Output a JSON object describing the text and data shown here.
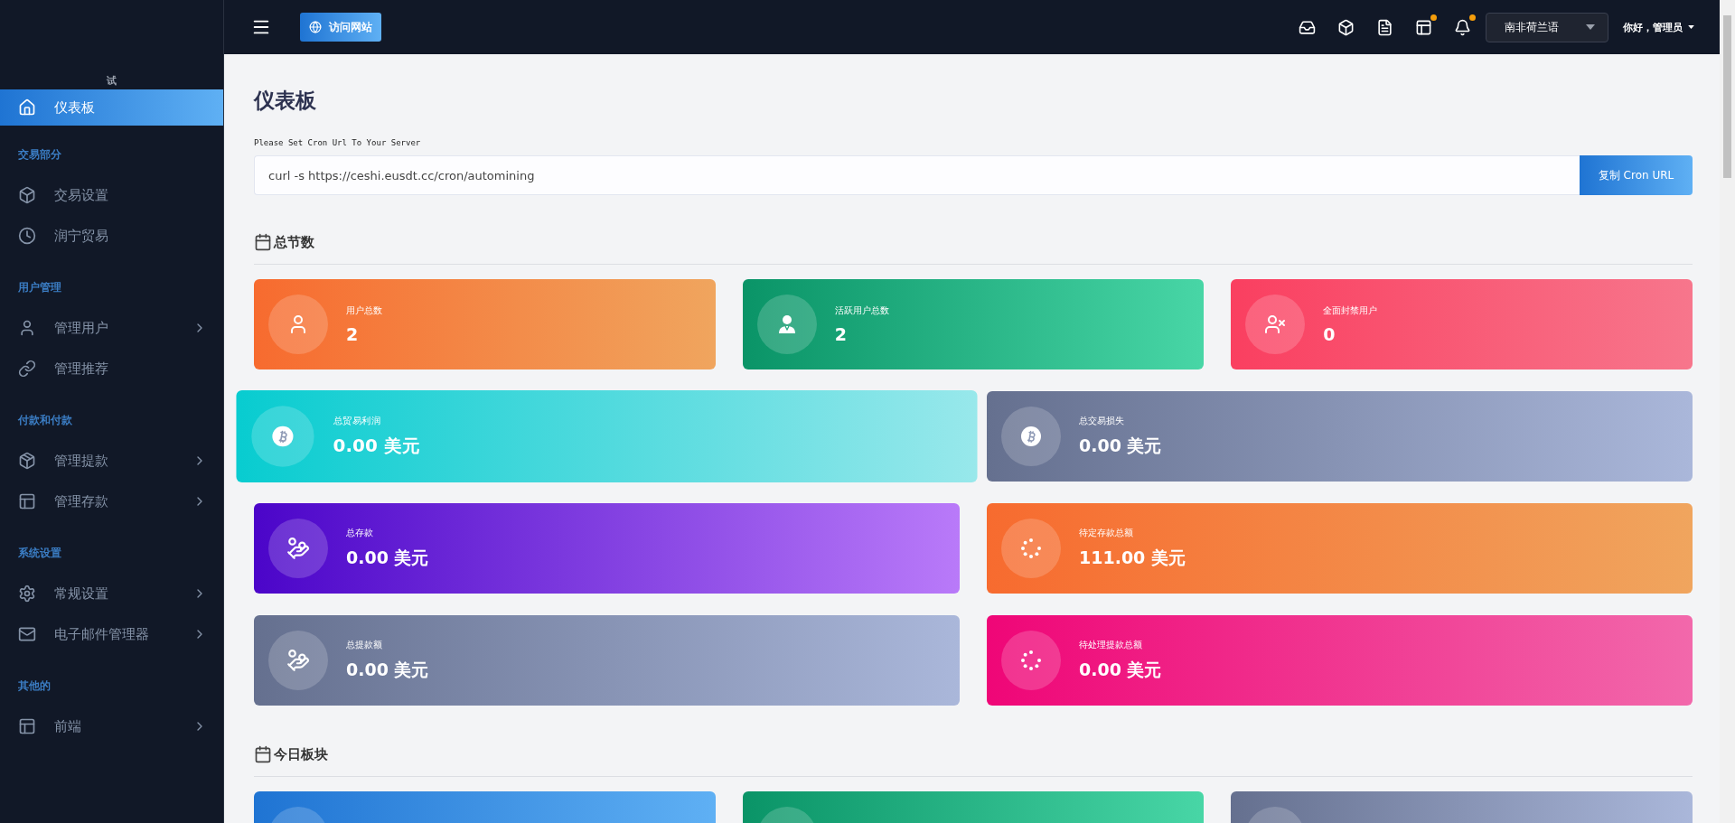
{
  "sidebar": {
    "brand": "试",
    "items": [
      {
        "label": "仪表板",
        "selected": true,
        "expandable": false
      }
    ],
    "sections": [
      {
        "title": "交易部分",
        "items": [
          {
            "label": "交易设置",
            "selected": false,
            "expandable": false
          },
          {
            "label": "润宁贸易",
            "selected": false,
            "expandable": false
          }
        ]
      },
      {
        "title": "用户管理",
        "items": [
          {
            "label": "管理用户",
            "selected": false,
            "expandable": true
          },
          {
            "label": "管理推荐",
            "selected": false,
            "expandable": false
          }
        ]
      },
      {
        "title": "付款和付款",
        "items": [
          {
            "label": "管理提款",
            "selected": false,
            "expandable": true
          },
          {
            "label": "管理存款",
            "selected": false,
            "expandable": true
          }
        ]
      },
      {
        "title": "系统设置",
        "items": [
          {
            "label": "常规设置",
            "selected": false,
            "expandable": true
          },
          {
            "label": "电子邮件管理器",
            "selected": false,
            "expandable": true
          }
        ]
      },
      {
        "title": "其他的",
        "items": [
          {
            "label": "前端",
            "selected": false,
            "expandable": true
          }
        ]
      }
    ]
  },
  "topbar": {
    "visit_button": "访问网站",
    "notifications": [
      {
        "dot": false
      },
      {
        "dot": false
      },
      {
        "dot": false
      },
      {
        "dot": true
      },
      {
        "dot": true
      }
    ],
    "language": "南非荷兰语",
    "user": "你好，管理员"
  },
  "page": {
    "title": "仪表板",
    "cron": {
      "label": "Please Set Cron Url To Your Server",
      "value": "curl -s https://ceshi.eusdt.cc/cron/automining",
      "button": "复制 Cron URL"
    },
    "sections": [
      {
        "title": "总节数",
        "rows": [
          [
            {
              "label": "用户总数",
              "value": "2",
              "hovered": false
            },
            {
              "label": "活跃用户总数",
              "value": "2",
              "hovered": false
            },
            {
              "label": "全面封禁用户",
              "value": "0",
              "hovered": false
            }
          ],
          [
            {
              "label": "总贸易利润",
              "value": "0.00 美元",
              "hovered": true
            },
            {
              "label": "总交易损失",
              "value": "0.00 美元",
              "hovered": false
            }
          ],
          [
            {
              "label": "总存款",
              "value": "0.00 美元",
              "hovered": false
            },
            {
              "label": "待定存款总额",
              "value": "111.00 美元",
              "hovered": false
            }
          ],
          [
            {
              "label": "总提款额",
              "value": "0.00 美元",
              "hovered": false
            },
            {
              "label": "待处理提款总额",
              "value": "0.00 美元",
              "hovered": false
            }
          ]
        ]
      },
      {
        "title": "今日板块",
        "rows": [
          [
            {
              "hovered": false
            },
            {
              "hovered": false
            },
            {
              "hovered": false
            }
          ]
        ]
      }
    ]
  }
}
